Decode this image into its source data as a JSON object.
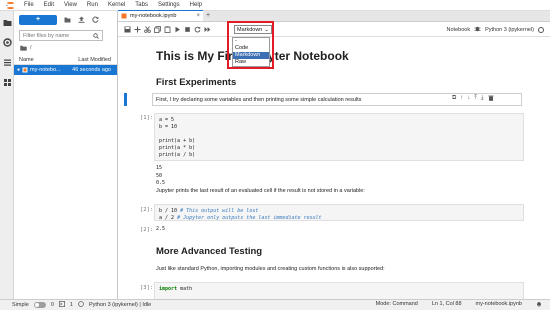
{
  "menubar": {
    "items": [
      "File",
      "Edit",
      "View",
      "Run",
      "Kernel",
      "Tabs",
      "Settings",
      "Help"
    ]
  },
  "sidebar": {
    "new_label": "+",
    "filter_placeholder": "Filter files by name",
    "breadcrumb": "/",
    "col_name": "Name",
    "col_modified": "Last Modified",
    "files": [
      {
        "name": "my-notebo...",
        "modified": "46 seconds ago"
      }
    ]
  },
  "tab": {
    "title": "my-notebook.ipynb",
    "close": "×",
    "add": "+"
  },
  "nbtoolbar": {
    "cell_type": "Markdown",
    "kernel_label": "Notebook",
    "kernel_name": "Python 3 (ipykernel)"
  },
  "dropdown": {
    "options": [
      "-",
      "Code",
      "Markdown",
      "Raw"
    ],
    "selected": "Markdown"
  },
  "notebook": {
    "title": "This is My First Jupyter Notebook",
    "h2_first": "First Experiments",
    "md1": "First, I try declaring some variables and then printing some simple calculation results",
    "prompt1": "[1]:",
    "code1": [
      "a = 5",
      "b = 10",
      "",
      "print(a + b)",
      "print(a * b)",
      "print(a / b)"
    ],
    "out1": [
      "15",
      "50",
      "0.5"
    ],
    "md2": "Jupyter prints the last result of an evaluated cell if the result is not stored in a variable:",
    "prompt2": "[2]:",
    "code2_line1": "b / 10",
    "code2_comment1": "# This output will be lost",
    "code2_line2": "a / 2",
    "code2_comment2": "# Jupyter only outputs the last immediate result",
    "prompt2_out": "[2]:",
    "out2": "2.5",
    "h2_more": "More Advanced Testing",
    "md3": "Just like standard Python, importing modules and creating custom functions is also supported:",
    "prompt3": "[3]:",
    "code3_kw": "import",
    "code3_mod": "math"
  },
  "statusbar": {
    "mode_label": "Simple",
    "num1": "0",
    "num2": "1",
    "kernel": "Python 3 (ipykernel) | Idle",
    "mode": "Mode: Command",
    "cursor": "Ln 1, Col 88",
    "file": "my-notebook.ipynb"
  }
}
